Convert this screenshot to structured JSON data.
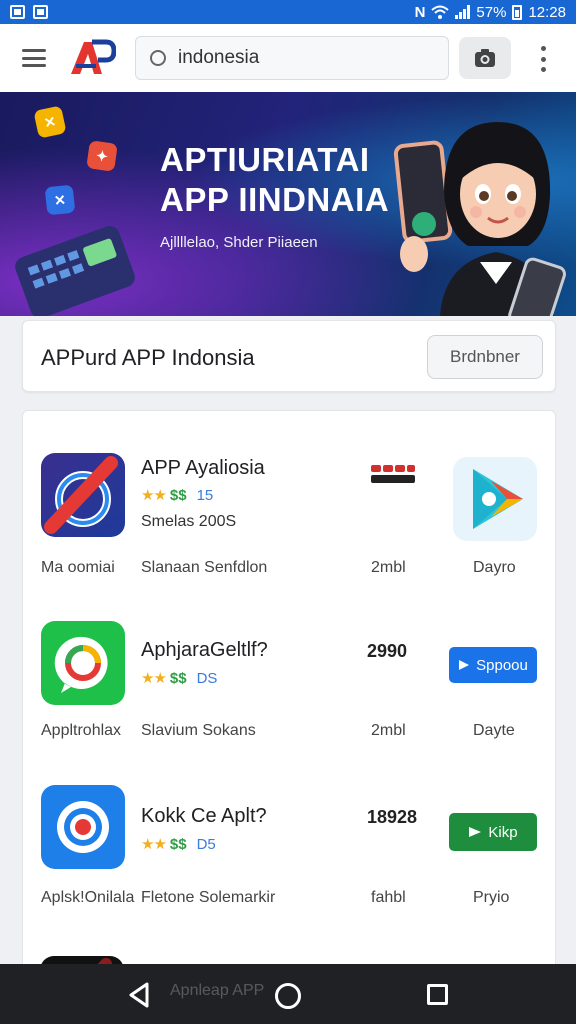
{
  "status": {
    "battery": "57%",
    "time": "12:28"
  },
  "search": {
    "query": "indonesia"
  },
  "banner": {
    "title_line1": "APTIURIATAI",
    "title_line2": "APP IINDNAIA",
    "subtitle": "Ajllllelao, Shder Piiaeen"
  },
  "header": {
    "title": "APPurd APP Indonsia",
    "button": "Brdnbner"
  },
  "apps": [
    {
      "name": "APP Ayaliosia",
      "stars": "★★",
      "dollar": "$$",
      "rating": "15",
      "meta": "Smelas 200S",
      "label": "Ma oomiai",
      "developer": "Slanaan Senfdlon",
      "size": "2mbl",
      "type": "Dayro",
      "icon": "target-blocked-icon"
    },
    {
      "name": "AphjaraGeltlf?",
      "stars": "★★",
      "dollar": "$$",
      "rating": "DS",
      "price": "2990",
      "label": "Appltrohlax",
      "developer": "Slavium Sokans",
      "size": "2mbl",
      "type": "Dayte",
      "button": "Sppoou",
      "icon": "chat-bubble-icon"
    },
    {
      "name": "Kokk Ce Aplt?",
      "stars": "★★",
      "dollar": "$$",
      "rating": "D5",
      "price": "18928",
      "label": "Aplsk!Onilala",
      "developer": "Fletone Solemarkir",
      "size": "fahbl",
      "type": "Pryio",
      "button": "Kikp",
      "icon": "record-target-icon"
    }
  ],
  "nav": {
    "ghost_label": "Apnleap APP"
  },
  "colors": {
    "status_bar": "#1967d2",
    "banner_start": "#1a1a5e",
    "banner_end": "#0d4d8a",
    "star": "#f2b01e",
    "install_blue": "#1a73e8",
    "install_green": "#1e8e3e"
  }
}
